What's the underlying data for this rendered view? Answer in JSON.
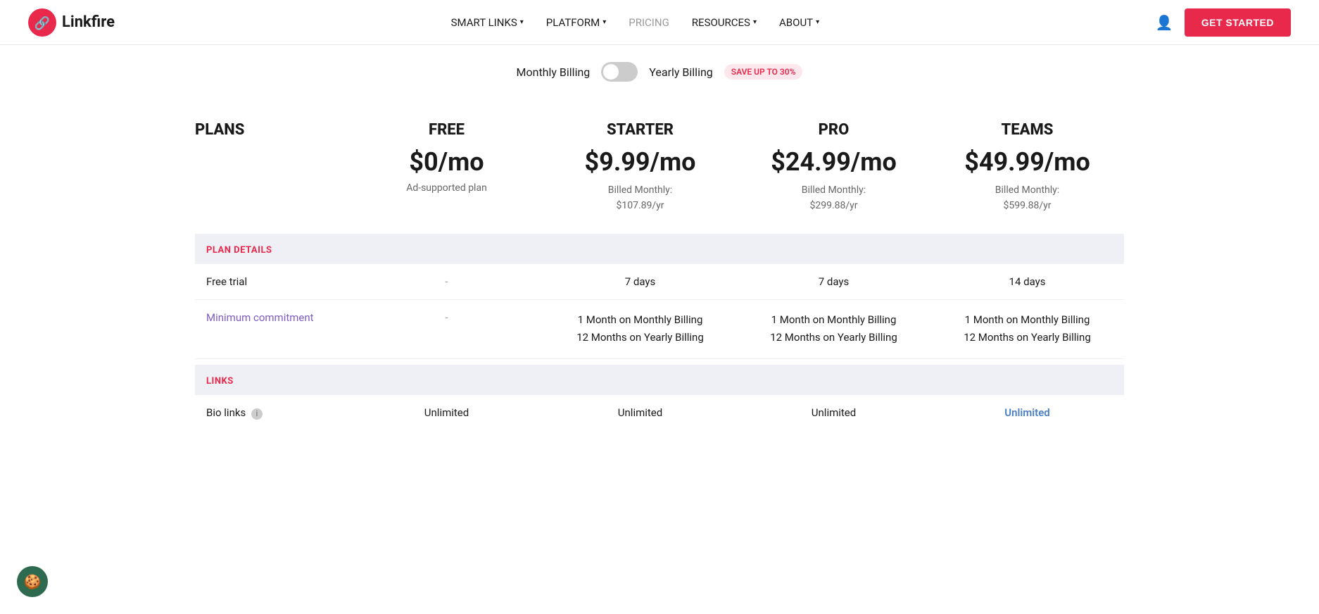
{
  "nav": {
    "logo_text": "Linkfire",
    "links": [
      {
        "label": "SMART LINKS",
        "has_dropdown": true
      },
      {
        "label": "PLATFORM",
        "has_dropdown": true
      },
      {
        "label": "PRICING",
        "has_dropdown": false,
        "active": true
      },
      {
        "label": "RESOURCES",
        "has_dropdown": true
      },
      {
        "label": "ABOUT",
        "has_dropdown": true
      }
    ],
    "cta_label": "GET STARTED"
  },
  "billing_toggle": {
    "monthly_label": "Monthly Billing",
    "yearly_label": "Yearly Billing",
    "save_badge": "SAVE UP TO 30%",
    "is_yearly": false
  },
  "pricing": {
    "plans_label": "PLANS",
    "columns": [
      {
        "name": "FREE",
        "price": "$0/mo",
        "desc": "Ad-supported plan",
        "billed_label": "",
        "billed_value": ""
      },
      {
        "name": "STARTER",
        "price": "$9.99/mo",
        "desc": "",
        "billed_label": "Billed Monthly:",
        "billed_value": "$107.89/yr"
      },
      {
        "name": "PRO",
        "price": "$24.99/mo",
        "desc": "",
        "billed_label": "Billed Monthly:",
        "billed_value": "$299.88/yr"
      },
      {
        "name": "TEAMS",
        "price": "$49.99/mo",
        "desc": "",
        "billed_label": "Billed Monthly:",
        "billed_value": "$599.88/yr"
      }
    ],
    "plan_details_label": "PLAN DETAILS",
    "rows": [
      {
        "label": "Free trial",
        "values": [
          "-",
          "7 days",
          "7 days",
          "14 days"
        ]
      },
      {
        "label": "Minimum commitment",
        "values": [
          "-",
          "1 Month on Monthly Billing\n12 Months on Yearly Billing",
          "1 Month on Monthly Billing\n12 Months on Yearly Billing",
          "1 Month on Monthly Billing\n12 Months on Yearly Billing"
        ]
      }
    ],
    "links_label": "LINKS",
    "links_rows": [
      {
        "label": "Bio links",
        "has_info": true,
        "values": [
          "Unlimited",
          "Unlimited",
          "Unlimited",
          "Unlimited"
        ]
      }
    ]
  }
}
